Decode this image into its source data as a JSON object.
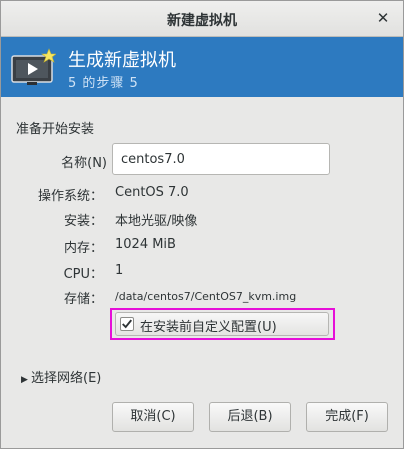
{
  "window": {
    "title": "新建虚拟机",
    "close_glyph": "✕"
  },
  "header": {
    "title": "生成新虚拟机",
    "step": "5 的步骤 5",
    "icon": "monitor-play-star-icon"
  },
  "section": {
    "title": "准备开始安装"
  },
  "form": {
    "name_label": "名称(N)",
    "name_value": "centos7.0",
    "os_label": "操作系统：",
    "os_value": "CentOS 7.0",
    "install_label": "安装：",
    "install_value": "本地光驱/映像",
    "memory_label": "内存：",
    "memory_value": "1024 MiB",
    "cpu_label": "CPU：",
    "cpu_value": "1",
    "storage_label": "存储：",
    "storage_value": "/data/centos7/CentOS7_kvm.img",
    "customize_label": "在安装前自定义配置(U)",
    "customize_checked": true
  },
  "network": {
    "label": "选择网络(E)",
    "expanded": false
  },
  "buttons": {
    "cancel": "取消(C)",
    "back": "后退(B)",
    "finish": "完成(F)"
  },
  "colors": {
    "header_bg": "#2d7ac0",
    "highlight_border": "#e60fd8"
  }
}
